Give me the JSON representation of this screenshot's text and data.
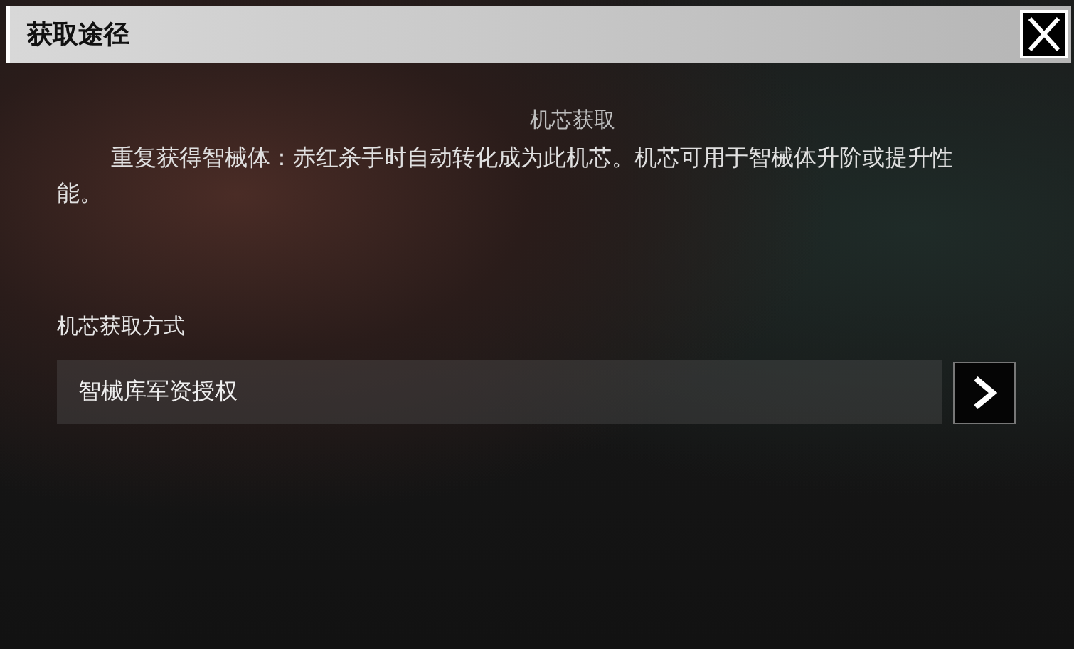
{
  "window": {
    "title": "获取途径"
  },
  "info": {
    "heading": "机芯获取",
    "description": "重复获得智械体：赤红杀手时自动转化成为此机芯。机芯可用于智械体升阶或提升性能。"
  },
  "section": {
    "label": "机芯获取方式",
    "items": [
      {
        "label": "智械库军资授权"
      }
    ]
  }
}
